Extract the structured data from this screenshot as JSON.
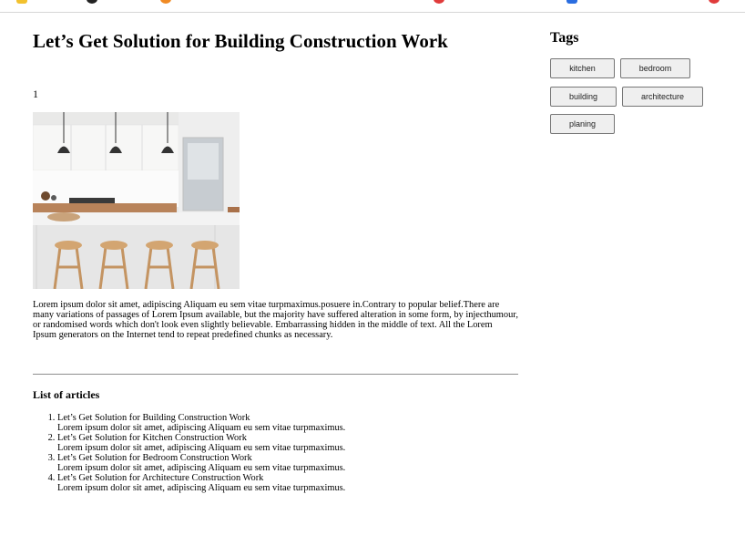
{
  "article": {
    "title": "Let’s Get Solution for Building Construction Work",
    "number": "1",
    "paragraph": "Lorem ipsum dolor sit amet, adipiscing Aliquam eu sem vitae turpmaximus.posuere in.Contrary to popular belief.There are many variations of passages of Lorem Ipsum available, but the majority have suffered alteration in some form, by injecthumour, or randomised words which don't look even slightly believable. Embarrassing hidden in the middle of text. All the Lorem Ipsum generators on the Internet tend to repeat predefined chunks as necessary."
  },
  "list": {
    "heading": "List of articles",
    "items": [
      {
        "title": "Let’s Get Solution for Building Construction Work",
        "desc": "Lorem ipsum dolor sit amet, adipiscing Aliquam eu sem vitae turpmaximus."
      },
      {
        "title": "Let’s Get Solution for Kitchen Construction Work",
        "desc": "Lorem ipsum dolor sit amet, adipiscing Aliquam eu sem vitae turpmaximus."
      },
      {
        "title": "Let’s Get Solution for Bedroom Construction Work",
        "desc": "Lorem ipsum dolor sit amet, adipiscing Aliquam eu sem vitae turpmaximus."
      },
      {
        "title": "Let’s Get Solution for Architecture Construction Work",
        "desc": "Lorem ipsum dolor sit amet, adipiscing Aliquam eu sem vitae turpmaximus."
      }
    ]
  },
  "sidebar": {
    "tags_heading": "Tags",
    "tags": [
      "kitchen",
      "bedroom",
      "building",
      "architecture",
      "planing"
    ]
  }
}
